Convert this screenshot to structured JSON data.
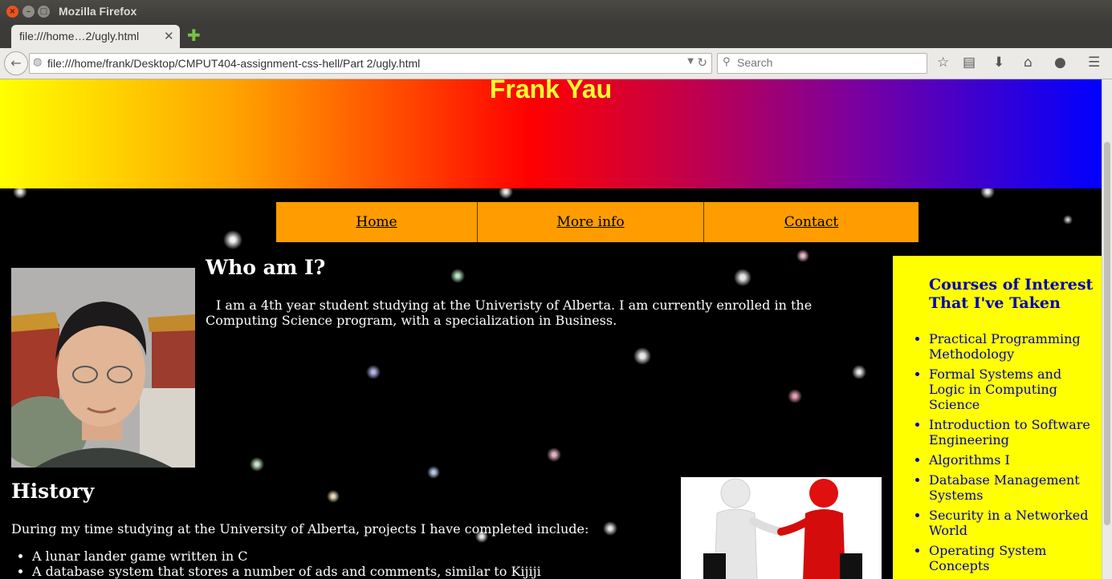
{
  "window": {
    "title": "Mozilla Firefox"
  },
  "tabs": [
    {
      "label": "file:///home…2/ugly.html",
      "active": true
    }
  ],
  "toolbar": {
    "url": "file:///home/frank/Desktop/CMPUT404-assignment-css-hell/Part 2/ugly.html",
    "search_placeholder": "Search",
    "icons": [
      "back-icon",
      "globe-icon",
      "reload-icon",
      "search-icon",
      "bookmark-star-icon",
      "reading-list-icon",
      "download-icon",
      "home-icon",
      "chat-icon",
      "menu-icon"
    ]
  },
  "page": {
    "header": {
      "title": "Frank Yau"
    },
    "nav": [
      {
        "label": "Home"
      },
      {
        "label": "More info"
      },
      {
        "label": "Contact"
      }
    ],
    "who": {
      "heading": "Who am I?",
      "text": "I am a 4th year student studying at the Univeristy of Alberta. I am currently enrolled in the Computing Science program, with a specialization in Business."
    },
    "history": {
      "heading": "History",
      "intro": "During my time studying at the University of Alberta, projects I have completed include:",
      "projects": [
        "A lunar lander game written in C",
        "A database system that stores a number of ads and comments, similar to Kijiji"
      ]
    },
    "sidebar": {
      "heading": "Courses of Interest That I've Taken",
      "courses": [
        "Practical Programming Methodology",
        "Formal Systems and Logic in Computing Science",
        "Introduction to Software Engineering",
        "Algorithms I",
        "Database Management Systems",
        "Security in a Networked World",
        "Operating System Concepts"
      ]
    }
  },
  "colors": {
    "banner_gradient": [
      "#ffff00",
      "#ff9f00",
      "#ff0000",
      "#7a00a0",
      "#0000ff"
    ],
    "title_text": "#ffff33",
    "nav_background": "#ff9c00",
    "sidebar_background": "#ffff00",
    "sidebar_text": "#0000b4",
    "page_background": "#000000"
  }
}
